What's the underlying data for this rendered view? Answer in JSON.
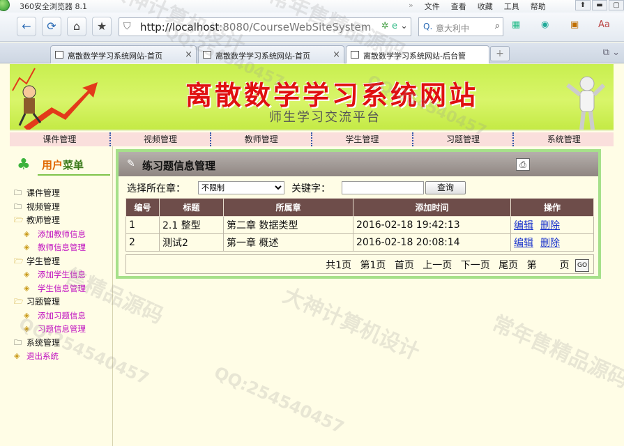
{
  "browser": {
    "app_title": "360安全浏览器 8.1",
    "menus": [
      "文件",
      "查看",
      "收藏",
      "工具",
      "帮助"
    ],
    "address_url_host": "http://localhost",
    "address_url_rest": ":8080/CourseWebSiteSystem",
    "search_placeholder": "意大利中",
    "tabs": [
      {
        "label": "离散数学学习系统网站-首页"
      },
      {
        "label": "离散数学学习系统网站-首页"
      },
      {
        "label": "离散数学学习系统网站-后台管"
      }
    ]
  },
  "site": {
    "title": "离散数学学习系统网站",
    "subtitle": "师生学习交流平台",
    "top_menu": [
      "课件管理",
      "视频管理",
      "教师管理",
      "学生管理",
      "习题管理",
      "系统管理"
    ]
  },
  "sidebar": {
    "heading_a": "用户",
    "heading_b": "菜单",
    "items": [
      {
        "label": "课件管理",
        "level": "top"
      },
      {
        "label": "视频管理",
        "level": "top"
      },
      {
        "label": "教师管理",
        "level": "top"
      },
      {
        "label": "添加教师信息",
        "level": "child"
      },
      {
        "label": "教师信息管理",
        "level": "child"
      },
      {
        "label": "学生管理",
        "level": "top"
      },
      {
        "label": "添加学生信息",
        "level": "child"
      },
      {
        "label": "学生信息管理",
        "level": "child"
      },
      {
        "label": "习题管理",
        "level": "top"
      },
      {
        "label": "添加习题信息",
        "level": "child"
      },
      {
        "label": "习题信息管理",
        "level": "child"
      },
      {
        "label": "系统管理",
        "level": "top"
      },
      {
        "label": "退出系统",
        "level": "child"
      }
    ]
  },
  "panel": {
    "title": "练习题信息管理",
    "filter_label": "选择所在章：",
    "filter_value": "不限制",
    "keyword_label": "关键字：",
    "query_button": "查询",
    "columns": [
      "编号",
      "标题",
      "所属章",
      "添加时间",
      "操作"
    ],
    "rows": [
      {
        "id": "1",
        "title": "2.1 整型",
        "chapter": "第二章 数据类型",
        "time": "2016-02-18 19:42:13",
        "edit": "编辑",
        "delete": "删除"
      },
      {
        "id": "2",
        "title": "测试2",
        "chapter": "第一章 概述",
        "time": "2016-02-18 20:08:14",
        "edit": "编辑",
        "delete": "删除"
      }
    ],
    "pager": {
      "total": "共1页",
      "current": "第1页",
      "first": "首页",
      "prev": "上一页",
      "next": "下一页",
      "last": "尾页",
      "jump_prefix": "第",
      "jump_suffix": "页",
      "go": "GO"
    }
  },
  "watermarks": [
    "大神计算机设计",
    "常年售精品源码",
    "QQ:254540457",
    "QQ:254540457",
    "大神计算机设计",
    "常年售精品源码",
    "QQ:254540457",
    "QQ:254540457",
    "售精品源码"
  ]
}
